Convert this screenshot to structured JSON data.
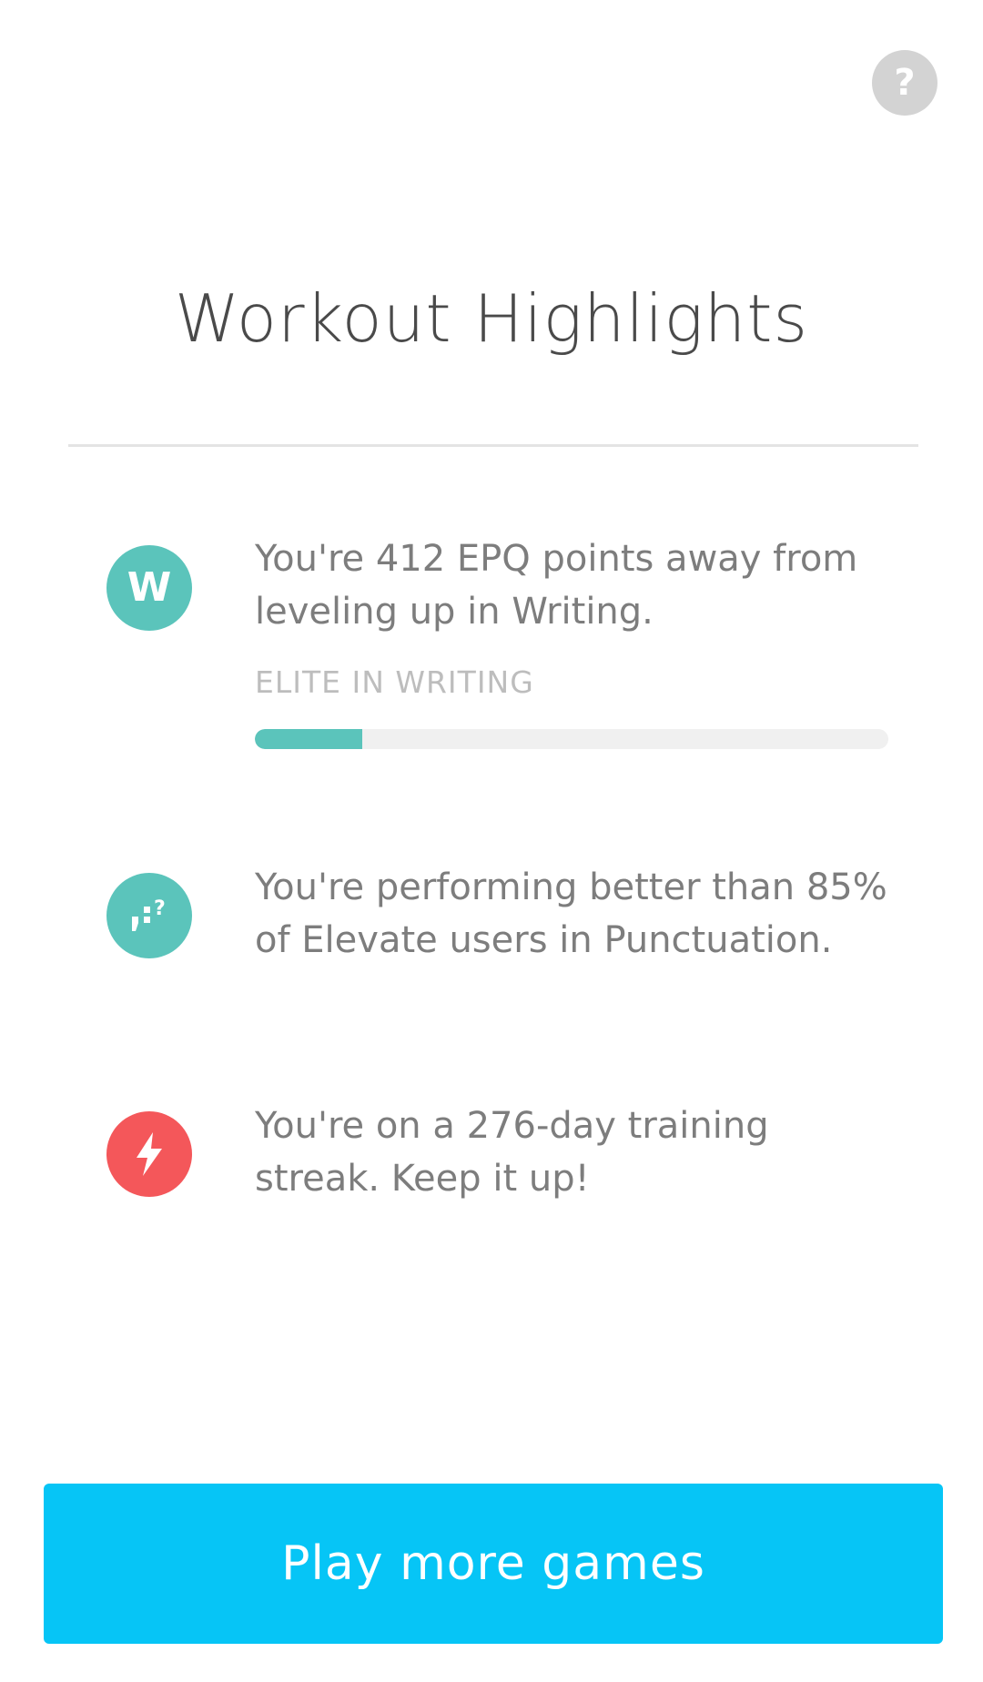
{
  "help": {
    "label": "?"
  },
  "title": "Workout Highlights",
  "highlights": [
    {
      "icon": "writing-w-icon",
      "icon_label": "W",
      "icon_color": "#5bc4bb",
      "text": "You're 412 EPQ points away from leveling up in Writing.",
      "progress_label": "ELITE IN WRITING",
      "progress_fraction": 0.17
    },
    {
      "icon": "punctuation-icon",
      "icon_color": "#5bc4bb",
      "text": "You're performing better than 85% of Elevate users in Punctuation."
    },
    {
      "icon": "lightning-bolt-icon",
      "icon_color": "#f4575a",
      "text": "You're on a 276-day training streak. Keep it up!"
    }
  ],
  "cta": {
    "label": "Play more games",
    "color": "#06c5f6"
  }
}
